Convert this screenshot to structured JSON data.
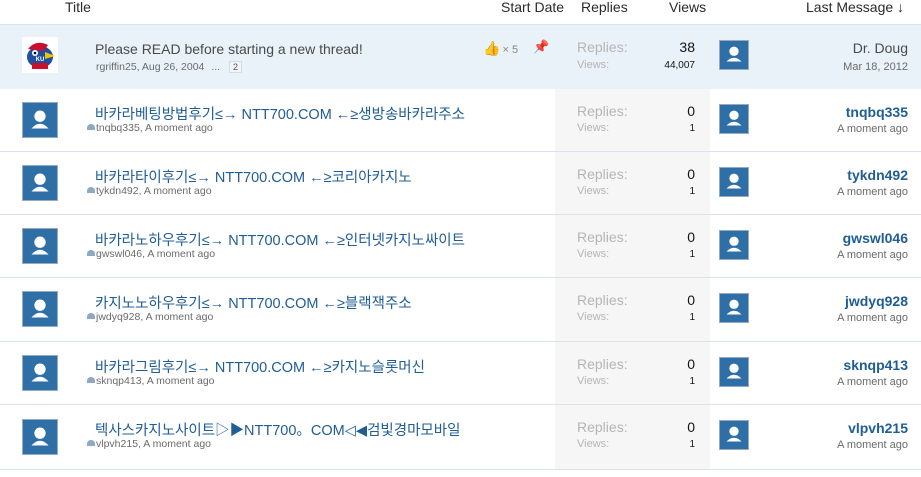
{
  "header": {
    "title": "Title",
    "start_date": "Start Date",
    "replies": "Replies",
    "views": "Views",
    "last_message": "Last Message ↓"
  },
  "labels": {
    "replies": "Replies:",
    "views": "Views:"
  },
  "sticky": {
    "title": "Please READ before starting a new thread!",
    "author_date": "rgriffin25, Aug 26, 2004",
    "ellipsis": "...",
    "page": "2",
    "likes": "5",
    "likes_prefix": "×",
    "replies": "38",
    "views": "44,007",
    "last_user": "Dr. Doug",
    "last_time": "Mar 18, 2012",
    "logo_text": "KU"
  },
  "threads": [
    {
      "title": "바카라베팅방법후기≤→ NTT700.COM ←≥생방송바카라주소",
      "meta": "tnqbq335, A moment ago",
      "replies": "0",
      "views": "1",
      "last_user": "tnqbq335",
      "last_time": "A moment ago"
    },
    {
      "title": "바카라타이후기≤→ NTT700.COM ←≥코리아카지노",
      "meta": "tykdn492, A moment ago",
      "replies": "0",
      "views": "1",
      "last_user": "tykdn492",
      "last_time": "A moment ago"
    },
    {
      "title": "바카라노하우후기≤→ NTT700.COM ←≥인터넷카지노싸이트",
      "meta": "gwswl046, A moment ago",
      "replies": "0",
      "views": "1",
      "last_user": "gwswl046",
      "last_time": "A moment ago"
    },
    {
      "title": "카지노노하우후기≤→ NTT700.COM ←≥블랙잭주소",
      "meta": "jwdyq928, A moment ago",
      "replies": "0",
      "views": "1",
      "last_user": "jwdyq928",
      "last_time": "A moment ago"
    },
    {
      "title": "바카라그림후기≤→ NTT700.COM ←≥카지노슬롯머신",
      "meta": "sknqp413, A moment ago",
      "replies": "0",
      "views": "1",
      "last_user": "sknqp413",
      "last_time": "A moment ago"
    },
    {
      "title": "텍사스카지노사이트▷▶NTT700。COM◁◀검빛경마모바일",
      "meta": "vlpvh215, A moment ago",
      "replies": "0",
      "views": "1",
      "last_user": "vlpvh215",
      "last_time": "A moment ago"
    }
  ],
  "icons": {
    "avatar": "default-avatar-icon",
    "like": "thumbs-up-icon",
    "sticky": "pin-icon",
    "unread": "unread-indicator-icon"
  },
  "colors": {
    "link": "#1f5d95",
    "avatar_bg": "#2f6fa8",
    "sticky_bg": "#e9f1f9"
  }
}
